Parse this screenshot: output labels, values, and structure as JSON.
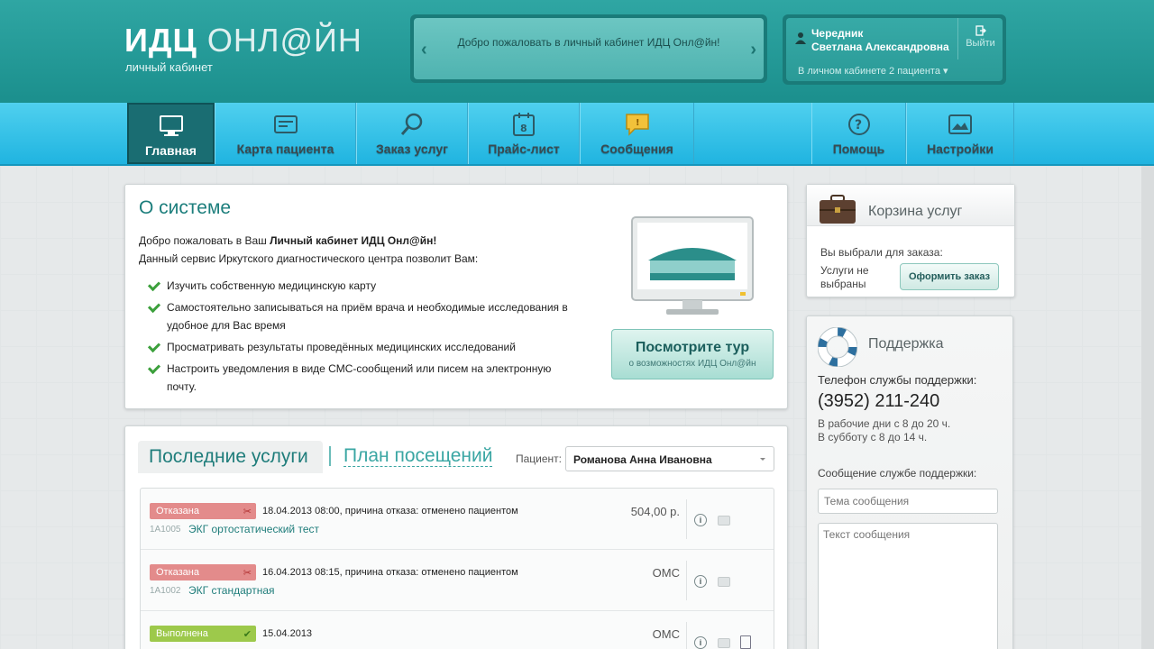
{
  "header": {
    "logo_bold": "ИДЦ",
    "logo_thin": "ОНЛ@ЙН",
    "logo_sub": "личный кабинет",
    "welcome": "Добро пожаловать в личный кабинет ИДЦ Онл@йн!",
    "user_last_name": "Чередник",
    "user_first_name": "Светлана Александровна",
    "logout": "Выйти",
    "patients_link": "В личном кабинете 2 пациента"
  },
  "nav": {
    "items": [
      {
        "label": "Главная",
        "icon": "monitor-icon"
      },
      {
        "label": "Карта пациента",
        "icon": "card-icon"
      },
      {
        "label": "Заказ услуг",
        "icon": "magnifier-icon"
      },
      {
        "label": "Прайс-лист",
        "icon": "calendar-icon"
      },
      {
        "label": "Сообщения",
        "icon": "message-icon"
      },
      {
        "label": "Помощь",
        "icon": "question-icon"
      },
      {
        "label": "Настройки",
        "icon": "settings-icon"
      }
    ]
  },
  "about": {
    "title": "О системе",
    "intro_prefix": "Добро пожаловать в Ваш ",
    "intro_bold": "Личный кабинет ИДЦ Онл@йн!",
    "intro_line2": "Данный сервис Иркутского диагностического центра позволит Вам:",
    "features": [
      "Изучить собственную медицинскую карту",
      "Самостоятельно записываться на приём врача и необходимые исследования в удобное для Вас время",
      "Просматривать результаты проведённых медицинских исследований",
      "Настроить уведомления в виде СМС-сообщений или писем на электронную почту."
    ],
    "tour_title": "Посмотрите тур",
    "tour_sub": "о возможностях ИДЦ Онл@йн"
  },
  "services": {
    "tab_last": "Последние услуги",
    "tab_plan": "План посещений",
    "patient_label": "Пациент:",
    "patient_value": "Романова Анна Ивановна",
    "rows": [
      {
        "status": "Отказана",
        "info": "18.04.2013 08:00, причина отказа: отменено пациентом",
        "code": "1A1005",
        "name": "ЭКГ ортостатический тест",
        "price": "504,00 р."
      },
      {
        "status": "Отказана",
        "info": "16.04.2013 08:15, причина отказа: отменено пациентом",
        "code": "1A1002",
        "name": "ЭКГ стандартная",
        "price": "ОМС"
      },
      {
        "status": "Выполнена",
        "info": "15.04.2013",
        "code": "",
        "name": "",
        "price": "ОМС"
      }
    ]
  },
  "cart": {
    "title": "Корзина услуг",
    "chosen_label": "Вы выбрали для заказа:",
    "none_text": "Услуги не выбраны",
    "order_button": "Оформить заказ"
  },
  "support": {
    "title": "Поддержка",
    "phone_label": "Телефон службы поддержки:",
    "phone": "(3952) 211-240",
    "hours_weekday": "В рабочие дни с 8 до 20 ч.",
    "hours_saturday": "В субботу с 8 до 14 ч.",
    "message_label": "Сообщение службе поддержки:",
    "topic_placeholder": "Тема сообщения",
    "text_placeholder": "Текст сообщения"
  },
  "colors": {
    "header": "#1f9a97",
    "nav": "#34c1e6",
    "accent": "#1f7d7b",
    "refused": "#e38b8b",
    "done": "#9dc94b"
  }
}
